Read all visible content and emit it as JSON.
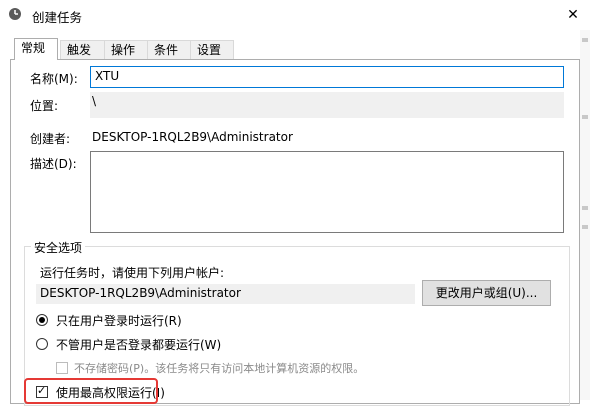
{
  "window": {
    "title": "创建任务",
    "close_glyph": "✕"
  },
  "tabs": [
    {
      "label": "常规",
      "active": true
    },
    {
      "label": "触发器"
    },
    {
      "label": "操作"
    },
    {
      "label": "条件"
    },
    {
      "label": "设置"
    }
  ],
  "general": {
    "name_label": "名称(M):",
    "name_value": "XTU",
    "location_label": "位置:",
    "location_value": "\\",
    "author_label": "创建者:",
    "author_value": "DESKTOP-1RQL2B9\\Administrator",
    "description_label": "描述(D):",
    "description_value": ""
  },
  "security": {
    "legend": "安全选项",
    "run_as_prompt": "运行任务时，请使用下列用户帐户:",
    "account_value": "DESKTOP-1RQL2B9\\Administrator",
    "change_user_button": "更改用户或组(U)...",
    "radio_logged_on": "只在用户登录时运行(R)",
    "radio_logged_on_selected": true,
    "radio_any": "不管用户是否登录都要运行(W)",
    "no_store_password": "不存储密码(P)。该任务将只有访问本地计算机资源的权限。",
    "highest_privileges": "使用最高权限运行(I)",
    "highest_privileges_checked": true
  },
  "colors": {
    "focus_border": "#0078d7",
    "highlight": "#e53935"
  }
}
